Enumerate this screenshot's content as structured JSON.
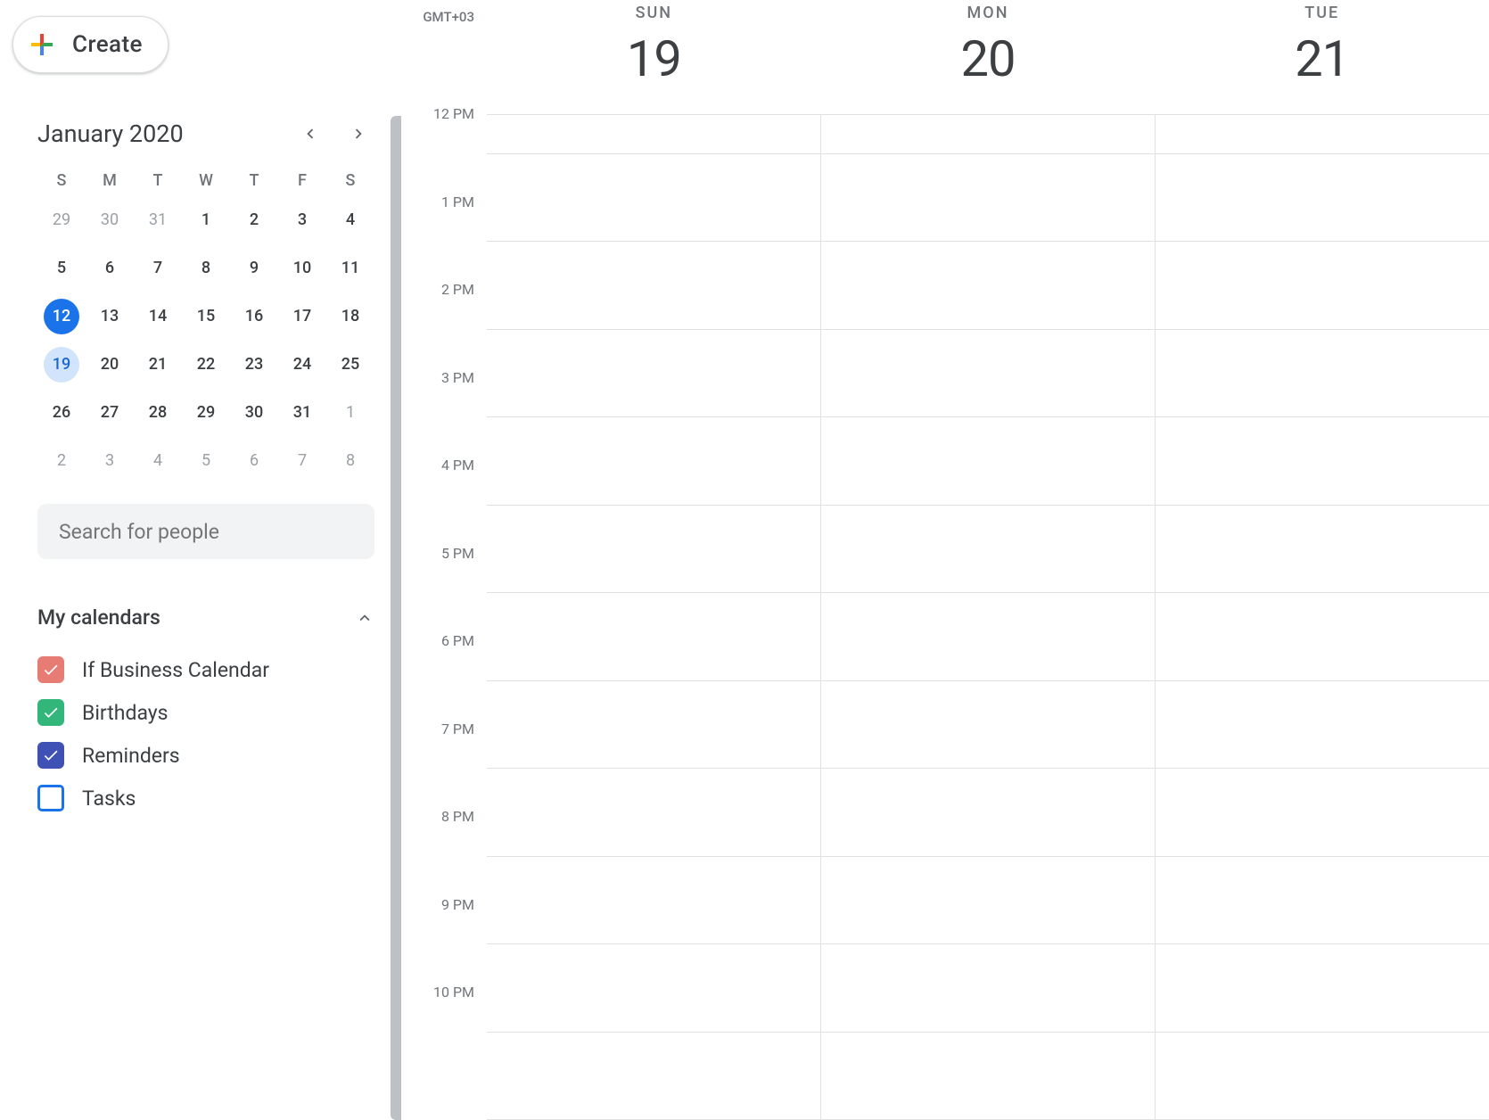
{
  "create_label": "Create",
  "minical": {
    "title": "January 2020",
    "dow": [
      "S",
      "M",
      "T",
      "W",
      "T",
      "F",
      "S"
    ],
    "weeks": [
      [
        {
          "n": "29",
          "other": true
        },
        {
          "n": "30",
          "other": true
        },
        {
          "n": "31",
          "other": true
        },
        {
          "n": "1"
        },
        {
          "n": "2"
        },
        {
          "n": "3"
        },
        {
          "n": "4"
        }
      ],
      [
        {
          "n": "5"
        },
        {
          "n": "6"
        },
        {
          "n": "7"
        },
        {
          "n": "8"
        },
        {
          "n": "9"
        },
        {
          "n": "10"
        },
        {
          "n": "11"
        }
      ],
      [
        {
          "n": "12",
          "today": true
        },
        {
          "n": "13"
        },
        {
          "n": "14"
        },
        {
          "n": "15"
        },
        {
          "n": "16"
        },
        {
          "n": "17"
        },
        {
          "n": "18"
        }
      ],
      [
        {
          "n": "19",
          "selected": true
        },
        {
          "n": "20"
        },
        {
          "n": "21"
        },
        {
          "n": "22"
        },
        {
          "n": "23"
        },
        {
          "n": "24"
        },
        {
          "n": "25"
        }
      ],
      [
        {
          "n": "26"
        },
        {
          "n": "27"
        },
        {
          "n": "28"
        },
        {
          "n": "29"
        },
        {
          "n": "30"
        },
        {
          "n": "31"
        },
        {
          "n": "1",
          "other": true
        }
      ],
      [
        {
          "n": "2",
          "other": true
        },
        {
          "n": "3",
          "other": true
        },
        {
          "n": "4",
          "other": true
        },
        {
          "n": "5",
          "other": true
        },
        {
          "n": "6",
          "other": true
        },
        {
          "n": "7",
          "other": true
        },
        {
          "n": "8",
          "other": true
        }
      ]
    ]
  },
  "search_placeholder": "Search for people",
  "calendars": {
    "section_title": "My calendars",
    "items": [
      {
        "name": "If Business Calendar",
        "color": "#e67c73",
        "checked": true
      },
      {
        "name": "Birthdays",
        "color": "#33b679",
        "checked": true
      },
      {
        "name": "Reminders",
        "color": "#3f51b5",
        "checked": true
      },
      {
        "name": "Tasks",
        "color": "#1a73e8",
        "checked": false
      }
    ]
  },
  "timezone": "GMT+03",
  "hours": [
    "12 PM",
    "1 PM",
    "2 PM",
    "3 PM",
    "4 PM",
    "5 PM",
    "6 PM",
    "7 PM",
    "8 PM",
    "9 PM",
    "10 PM"
  ],
  "days": [
    {
      "dow": "SUN",
      "num": "19"
    },
    {
      "dow": "MON",
      "num": "20"
    },
    {
      "dow": "TUE",
      "num": "21"
    }
  ]
}
